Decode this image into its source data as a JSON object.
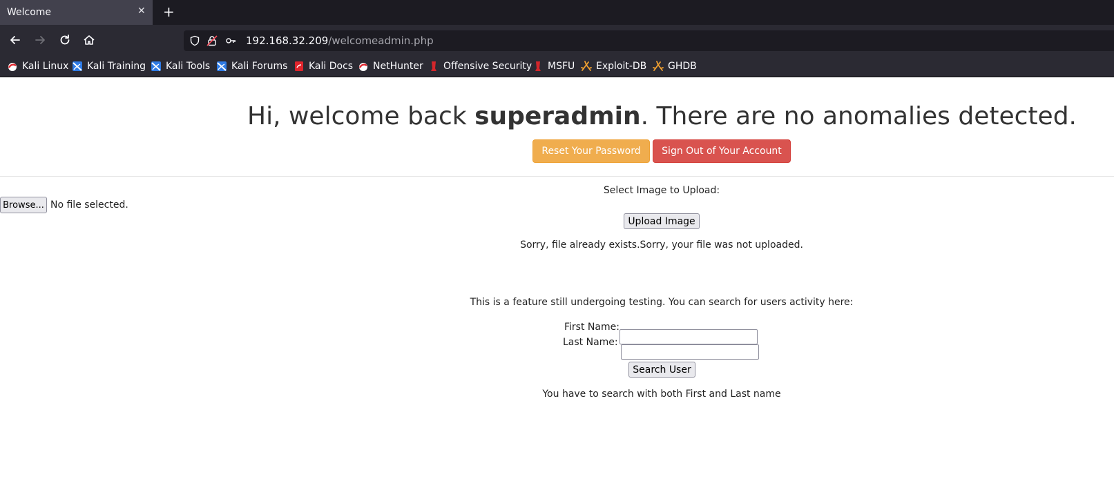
{
  "browser": {
    "tab_title": "Welcome",
    "tab_close": "✕",
    "new_tab": "+",
    "url_host": "192.168.32.209",
    "url_path": "/welcomeadmin.php"
  },
  "bookmarks": [
    {
      "label": "Kali Linux",
      "icon": "kali-dragon-icon"
    },
    {
      "label": "Kali Training",
      "icon": "kali-training-icon"
    },
    {
      "label": "Kali Tools",
      "icon": "kali-tools-icon"
    },
    {
      "label": "Kali Forums",
      "icon": "kali-forums-icon"
    },
    {
      "label": "Kali Docs",
      "icon": "kali-docs-icon"
    },
    {
      "label": "NetHunter",
      "icon": "nethunter-icon"
    },
    {
      "label": "Offensive Security",
      "icon": "offsec-icon"
    },
    {
      "label": "MSFU",
      "icon": "msfu-icon"
    },
    {
      "label": "Exploit-DB",
      "icon": "exploit-db-icon"
    },
    {
      "label": "GHDB",
      "icon": "ghdb-icon"
    }
  ],
  "page": {
    "welcome_prefix": "Hi, welcome back ",
    "username": "superadmin",
    "welcome_suffix": ". There are no anomalies detected.",
    "reset_password": "Reset Your Password",
    "sign_out": "Sign Out of Your Account",
    "select_image": "Select Image to Upload:",
    "browse": "Browse...",
    "no_file": "No file selected.",
    "upload_image": "Upload Image",
    "upload_message": "Sorry, file already exists.Sorry, your file was not uploaded.",
    "feature_note": "This is a feature still undergoing testing. You can search for users activity here:",
    "first_name_label": "First Name:",
    "first_name_value": "",
    "last_name_label": "Last Name:",
    "last_name_value": "",
    "search_user": "Search User",
    "search_message": "You have to search with both First and Last name"
  }
}
